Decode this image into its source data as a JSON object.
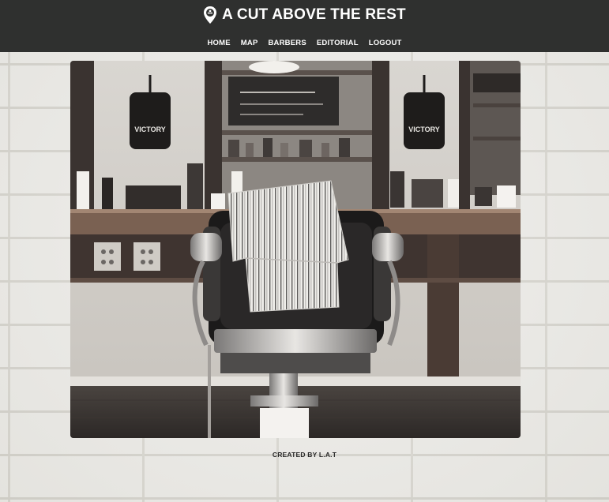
{
  "header": {
    "title": "A CUT ABOVE THE REST",
    "logo_icon": "map-pin-mustache-icon",
    "background": "#2f302f"
  },
  "nav": {
    "items": [
      {
        "label": "HOME"
      },
      {
        "label": "MAP"
      },
      {
        "label": "BARBERS"
      },
      {
        "label": "EDITORIAL"
      },
      {
        "label": "LOGOUT"
      }
    ]
  },
  "hero": {
    "mirror_sign_left": "VICTORY",
    "mirror_sign_right": "VICTORY"
  },
  "footer": {
    "credit": "CREATED BY L.A.T"
  }
}
